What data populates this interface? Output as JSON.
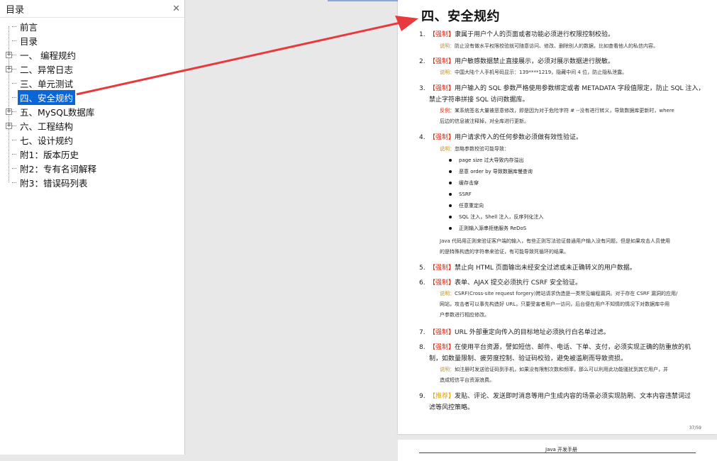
{
  "sidebar": {
    "title": "目录",
    "close_glyph": "✕",
    "items": [
      {
        "label": "前言",
        "expandable": false,
        "selected": false
      },
      {
        "label": "目录",
        "expandable": false,
        "selected": false
      },
      {
        "label": "一、 编程规约",
        "expandable": true,
        "selected": false
      },
      {
        "label": "二、异常日志",
        "expandable": true,
        "selected": false
      },
      {
        "label": "三、单元测试",
        "expandable": false,
        "selected": false
      },
      {
        "label": "四、安全规约",
        "expandable": false,
        "selected": true
      },
      {
        "label": "五、MySQL数据库",
        "expandable": true,
        "selected": false
      },
      {
        "label": "六、工程结构",
        "expandable": true,
        "selected": false
      },
      {
        "label": "七、设计规约",
        "expandable": false,
        "selected": false
      },
      {
        "label": "附1：版本历史",
        "expandable": false,
        "selected": false
      },
      {
        "label": "附2：专有名词解释",
        "expandable": false,
        "selected": false
      },
      {
        "label": "附3：错误码列表",
        "expandable": false,
        "selected": false
      }
    ]
  },
  "document": {
    "section_title": "四、安全规约",
    "rules": [
      {
        "num": "1.",
        "tag": "【强制】",
        "text": "隶属于用户个人的页面或者功能必须进行权限控制校验。",
        "note_key": "说明：",
        "note": "防止没有做水平权限校验就可随意访问、修改、删除别人的数据，比如查看他人的私信内容。"
      },
      {
        "num": "2.",
        "tag": "【强制】",
        "text": "用户敏感数据禁止直接展示，必须对展示数据进行脱敏。",
        "note_key": "说明：",
        "note": "中国大陆个人手机号码显示：139****1219，隐藏中间 4 位，防止隐私泄露。"
      },
      {
        "num": "3.",
        "tag": "【强制】",
        "text_l1": "用户输入的 SQL 参数严格使用参数绑定或者 METADATA 字段值限定，防止 SQL 注入，",
        "text_l2": "禁止字符串拼接 SQL 访问数据库。",
        "note_key": "反例：",
        "note_l1": "某系统签名大量被恶意修改，即是因为对于危险字符 # --没有进行转义，导致数据库更新时，where",
        "note_l2": "后边的信息被注释掉，对全库进行更新。"
      },
      {
        "num": "4.",
        "tag": "【强制】",
        "text": "用户请求传入的任何参数必须做有效性验证。",
        "note_key": "说明：",
        "note": "忽略参数校验可能导致："
      },
      {
        "num": "5.",
        "tag": "【强制】",
        "text": "禁止向 HTML 页面输出未经安全过滤或未正确转义的用户数据。"
      },
      {
        "num": "6.",
        "tag": "【强制】",
        "text": "表单、AJAX 提交必须执行 CSRF 安全验证。",
        "note_key": "说明：",
        "note_l1": "CSRF(Cross-site request forgery)跨站请求伪造是一类常见编程漏洞。对于存在 CSRF 漏洞的应用/",
        "note_l2": "网站，攻击者可以事先构造好 URL，只要受害者用户一访问，后台便在用户不知情的情况下对数据库中用",
        "note_l3": "户参数进行相应修改。"
      },
      {
        "num": "7.",
        "tag": "【强制】",
        "text": "URL 外部重定向传入的目标地址必须执行白名单过滤。"
      },
      {
        "num": "8.",
        "tag": "【强制】",
        "text_l1": "在使用平台资源，譬如短信、邮件、电话、下单、支付，必须实现正确的防重放的机",
        "text_l2": "制，如数量限制、疲劳度控制、验证码校验，避免被滥刷而导致资损。",
        "note_key": "说明：",
        "note_l1": "如注册时发送验证码到手机，如果没有限制次数和频率，那么可以利用此功能骚扰到其它用户，并",
        "note_l2": "造成短信平台资源浪费。"
      },
      {
        "num": "9.",
        "tag": "【推荐】",
        "text_l1": "发贴、评论、发送即时消息等用户生成内容的场景必须实现防刷、文本内容违禁词过",
        "text_l2": "滤等风控策略。"
      }
    ],
    "bullets": [
      "page size 过大导致内存溢出",
      "恶意 order by 导致数据库慢查询",
      "缓存击穿",
      "SSRF",
      "任意重定向",
      "SQL 注入，Shell 注入，反序列化注入",
      "正则输入源串拒绝服务 ReDoS"
    ],
    "java_para_l1": "Java 代码用正则来验证客户端的输入，有些正则写法验证普通用户输入没有问题，但是如果攻击人员使用",
    "java_para_l2": "的是特殊构造的字符串来验证，有可能导致死循环的结果。",
    "page_number": "37/59",
    "next_page_header": "Java 开发手册"
  },
  "colors": {
    "selection": "#0a66d6",
    "arrow": "#e8393d",
    "tag_forced": "#d81e06",
    "tag_recommended": "#e0a300"
  }
}
